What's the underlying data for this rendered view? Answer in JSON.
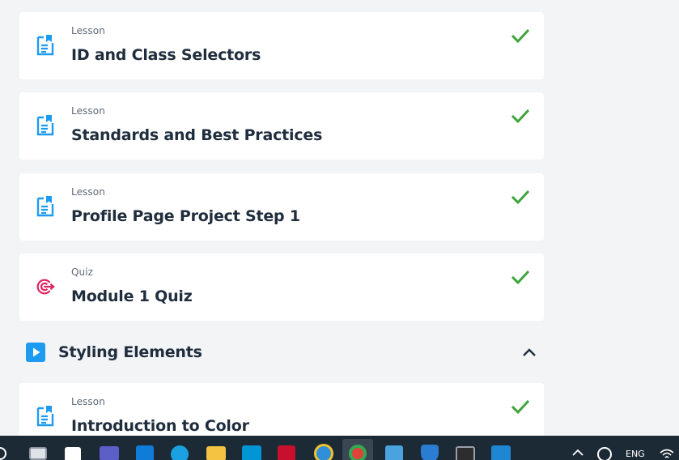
{
  "items": [
    {
      "kind": "Lesson",
      "title": "ID and Class Selectors",
      "icon": "document-icon",
      "completed": true
    },
    {
      "kind": "Lesson",
      "title": "Standards and Best Practices",
      "icon": "document-icon",
      "completed": true
    },
    {
      "kind": "Lesson",
      "title": "Profile Page Project Step 1",
      "icon": "document-icon",
      "completed": true
    },
    {
      "kind": "Quiz",
      "title": "Module 1 Quiz",
      "icon": "target-icon",
      "completed": true
    },
    {
      "kind": "Lesson",
      "title": "Introduction to Color",
      "icon": "document-icon",
      "completed": true
    }
  ],
  "section": {
    "title": "Styling Elements",
    "expanded": true
  },
  "colors": {
    "accent": "#1d9bf0",
    "check": "#3ea43a",
    "quiz": "#e0245e",
    "title": "#1f2d3d",
    "muted": "#5f6a76",
    "background": "#f2f4f6"
  },
  "taskbar": {
    "language": "ENG",
    "icons": [
      "search-icon",
      "task-view-icon",
      "capcut-icon",
      "teams-icon",
      "store-icon",
      "edge-icon",
      "file-explorer-icon",
      "myhp-icon",
      "mcafee-icon",
      "help-icon",
      "chrome-icon",
      "photos-icon",
      "security-icon",
      "terminal-icon",
      "vscode-icon",
      "chevron-up-icon",
      "sync-icon",
      "wifi-icon"
    ]
  }
}
